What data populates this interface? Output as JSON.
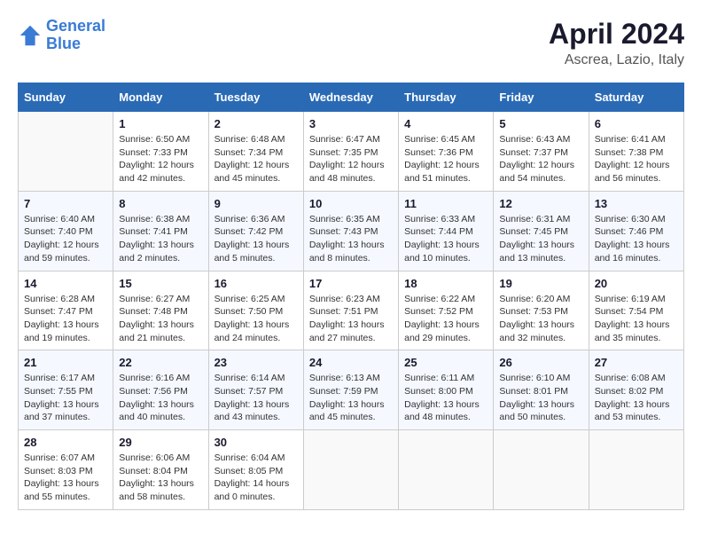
{
  "logo": {
    "line1": "General",
    "line2": "Blue"
  },
  "title": "April 2024",
  "subtitle": "Ascrea, Lazio, Italy",
  "days_of_week": [
    "Sunday",
    "Monday",
    "Tuesday",
    "Wednesday",
    "Thursday",
    "Friday",
    "Saturday"
  ],
  "weeks": [
    [
      {
        "day": "",
        "info": ""
      },
      {
        "day": "1",
        "info": "Sunrise: 6:50 AM\nSunset: 7:33 PM\nDaylight: 12 hours\nand 42 minutes."
      },
      {
        "day": "2",
        "info": "Sunrise: 6:48 AM\nSunset: 7:34 PM\nDaylight: 12 hours\nand 45 minutes."
      },
      {
        "day": "3",
        "info": "Sunrise: 6:47 AM\nSunset: 7:35 PM\nDaylight: 12 hours\nand 48 minutes."
      },
      {
        "day": "4",
        "info": "Sunrise: 6:45 AM\nSunset: 7:36 PM\nDaylight: 12 hours\nand 51 minutes."
      },
      {
        "day": "5",
        "info": "Sunrise: 6:43 AM\nSunset: 7:37 PM\nDaylight: 12 hours\nand 54 minutes."
      },
      {
        "day": "6",
        "info": "Sunrise: 6:41 AM\nSunset: 7:38 PM\nDaylight: 12 hours\nand 56 minutes."
      }
    ],
    [
      {
        "day": "7",
        "info": "Sunrise: 6:40 AM\nSunset: 7:40 PM\nDaylight: 12 hours\nand 59 minutes."
      },
      {
        "day": "8",
        "info": "Sunrise: 6:38 AM\nSunset: 7:41 PM\nDaylight: 13 hours\nand 2 minutes."
      },
      {
        "day": "9",
        "info": "Sunrise: 6:36 AM\nSunset: 7:42 PM\nDaylight: 13 hours\nand 5 minutes."
      },
      {
        "day": "10",
        "info": "Sunrise: 6:35 AM\nSunset: 7:43 PM\nDaylight: 13 hours\nand 8 minutes."
      },
      {
        "day": "11",
        "info": "Sunrise: 6:33 AM\nSunset: 7:44 PM\nDaylight: 13 hours\nand 10 minutes."
      },
      {
        "day": "12",
        "info": "Sunrise: 6:31 AM\nSunset: 7:45 PM\nDaylight: 13 hours\nand 13 minutes."
      },
      {
        "day": "13",
        "info": "Sunrise: 6:30 AM\nSunset: 7:46 PM\nDaylight: 13 hours\nand 16 minutes."
      }
    ],
    [
      {
        "day": "14",
        "info": "Sunrise: 6:28 AM\nSunset: 7:47 PM\nDaylight: 13 hours\nand 19 minutes."
      },
      {
        "day": "15",
        "info": "Sunrise: 6:27 AM\nSunset: 7:48 PM\nDaylight: 13 hours\nand 21 minutes."
      },
      {
        "day": "16",
        "info": "Sunrise: 6:25 AM\nSunset: 7:50 PM\nDaylight: 13 hours\nand 24 minutes."
      },
      {
        "day": "17",
        "info": "Sunrise: 6:23 AM\nSunset: 7:51 PM\nDaylight: 13 hours\nand 27 minutes."
      },
      {
        "day": "18",
        "info": "Sunrise: 6:22 AM\nSunset: 7:52 PM\nDaylight: 13 hours\nand 29 minutes."
      },
      {
        "day": "19",
        "info": "Sunrise: 6:20 AM\nSunset: 7:53 PM\nDaylight: 13 hours\nand 32 minutes."
      },
      {
        "day": "20",
        "info": "Sunrise: 6:19 AM\nSunset: 7:54 PM\nDaylight: 13 hours\nand 35 minutes."
      }
    ],
    [
      {
        "day": "21",
        "info": "Sunrise: 6:17 AM\nSunset: 7:55 PM\nDaylight: 13 hours\nand 37 minutes."
      },
      {
        "day": "22",
        "info": "Sunrise: 6:16 AM\nSunset: 7:56 PM\nDaylight: 13 hours\nand 40 minutes."
      },
      {
        "day": "23",
        "info": "Sunrise: 6:14 AM\nSunset: 7:57 PM\nDaylight: 13 hours\nand 43 minutes."
      },
      {
        "day": "24",
        "info": "Sunrise: 6:13 AM\nSunset: 7:59 PM\nDaylight: 13 hours\nand 45 minutes."
      },
      {
        "day": "25",
        "info": "Sunrise: 6:11 AM\nSunset: 8:00 PM\nDaylight: 13 hours\nand 48 minutes."
      },
      {
        "day": "26",
        "info": "Sunrise: 6:10 AM\nSunset: 8:01 PM\nDaylight: 13 hours\nand 50 minutes."
      },
      {
        "day": "27",
        "info": "Sunrise: 6:08 AM\nSunset: 8:02 PM\nDaylight: 13 hours\nand 53 minutes."
      }
    ],
    [
      {
        "day": "28",
        "info": "Sunrise: 6:07 AM\nSunset: 8:03 PM\nDaylight: 13 hours\nand 55 minutes."
      },
      {
        "day": "29",
        "info": "Sunrise: 6:06 AM\nSunset: 8:04 PM\nDaylight: 13 hours\nand 58 minutes."
      },
      {
        "day": "30",
        "info": "Sunrise: 6:04 AM\nSunset: 8:05 PM\nDaylight: 14 hours\nand 0 minutes."
      },
      {
        "day": "",
        "info": ""
      },
      {
        "day": "",
        "info": ""
      },
      {
        "day": "",
        "info": ""
      },
      {
        "day": "",
        "info": ""
      }
    ]
  ]
}
